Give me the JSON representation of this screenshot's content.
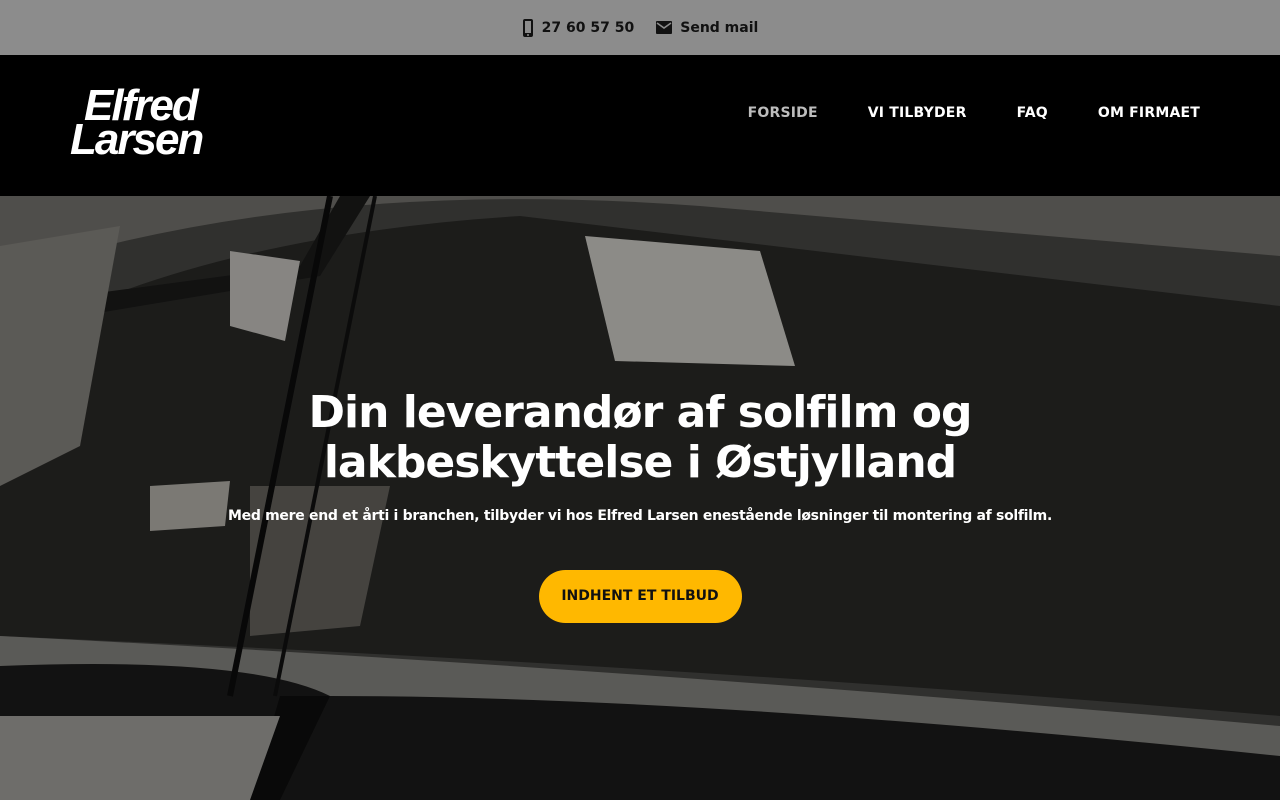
{
  "topbar": {
    "phone": "27 60 57 50",
    "phone_icon": "phone-icon",
    "mail": "Send mail",
    "mail_icon": "mail-icon"
  },
  "header": {
    "logo_line1": "Elfred",
    "logo_line2": "Larsen",
    "nav": [
      {
        "label": "FORSIDE",
        "active": true
      },
      {
        "label": "VI TILBYDER",
        "active": false
      },
      {
        "label": "FAQ",
        "active": false
      },
      {
        "label": "OM FIRMAET",
        "active": false
      }
    ]
  },
  "hero": {
    "title": "Din leverandør af solfilm og lakbeskyttelse i Østjylland",
    "subtitle": "Med mere end et årti i branchen, tilbyder vi hos Elfred Larsen enestående løsninger til montering af solfilm.",
    "cta_label": "INDHENT ET TILBUD"
  },
  "colors": {
    "topbar_bg": "#8c8c8c",
    "header_bg": "#000000",
    "cta_bg": "#ffb800",
    "nav_active": "#bdbdbd"
  }
}
